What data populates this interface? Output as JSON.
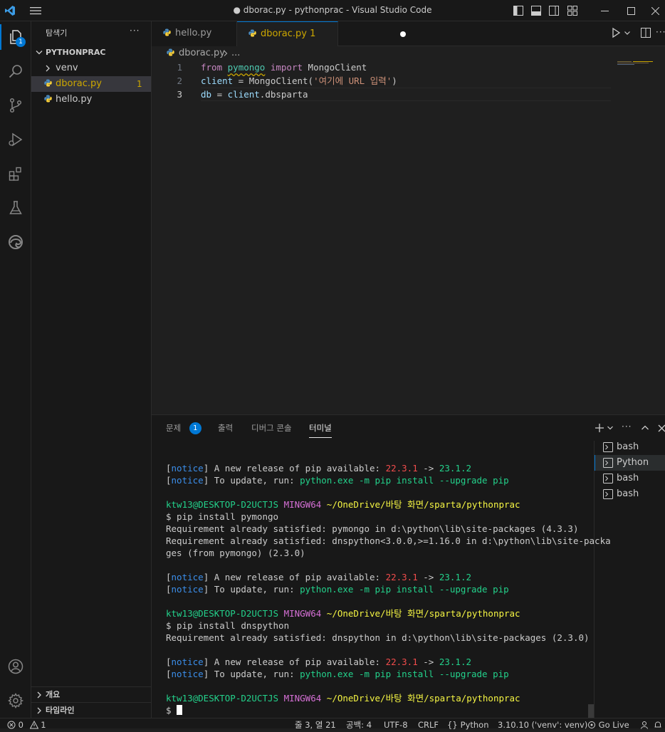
{
  "window": {
    "title": "● dborac.py - pythonprac - Visual Studio Code"
  },
  "activity": {
    "explorer_badge": "1"
  },
  "sidebar": {
    "header": "탐색기",
    "more": "···",
    "project": "PYTHONPRAC",
    "items": [
      {
        "label": "venv"
      },
      {
        "label": "dborac.py",
        "problems": "1"
      },
      {
        "label": "hello.py"
      }
    ],
    "outline": "개요",
    "timeline": "타임라인"
  },
  "tabs": [
    {
      "label": "hello.py"
    },
    {
      "label": "dborac.py 1"
    }
  ],
  "breadcrumb": {
    "file": "dborac.py",
    "rest": "..."
  },
  "editor": {
    "lines": [
      {
        "no": "1",
        "t1": "from",
        "t2": " ",
        "t3": "pymongo",
        "t4": " ",
        "t5": "import",
        "t6": " ",
        "t7": "MongoClient"
      },
      {
        "no": "2",
        "t1": "client",
        "t2": " = ",
        "t3": "MongoClient",
        "t4": "(",
        "t5": "'여기에 URL 입력'",
        "t6": ")"
      },
      {
        "no": "3",
        "t1": "db",
        "t2": " = ",
        "t3": "client",
        "t4": ".dbsparta"
      }
    ]
  },
  "panel": {
    "tabs": [
      {
        "label": "문제",
        "badge": "1"
      },
      {
        "label": "출력"
      },
      {
        "label": "디버그 콘솔"
      },
      {
        "label": "터미널"
      }
    ],
    "terminals": [
      {
        "label": "bash"
      },
      {
        "label": "Python"
      },
      {
        "label": "bash"
      },
      {
        "label": "bash"
      }
    ]
  },
  "terminal": {
    "notice1a": "notice",
    "notice1b": " A new release of pip available: ",
    "ver_old": "22.3.1",
    "arrow": " -> ",
    "ver_new": "23.1.2",
    "notice2b": " To update, run: ",
    "cmd_upgrade": "python.exe -m pip install --upgrade pip",
    "user": "ktw13@DESKTOP-D2UCTJS",
    "env": "MINGW64",
    "path": "~/OneDrive/바탕 화면/sparta/pythonprac",
    "cmd1": "$ pip install pymongo",
    "req1": "Requirement already satisfied: pymongo in d:\\python\\lib\\site-packages (4.3.3)",
    "req2a": "Requirement already satisfied: dnspython<3.0.0,>=1.16.0 in d:\\python\\lib\\site-packa",
    "req2b": "ges (from pymongo) (2.3.0)",
    "cmd2": "$ pip install dnspython",
    "req3": "Requirement already satisfied: dnspython in d:\\python\\lib\\site-packages (2.3.0)",
    "prompt": "$ "
  },
  "status": {
    "errors": "0",
    "warnings": "1",
    "position": "줄 3, 열 21",
    "spaces": "공백: 4",
    "encoding": "UTF-8",
    "eol": "CRLF",
    "language": "Python",
    "interpreter": "3.10.10 ('venv': venv)",
    "golive": "Go Live"
  }
}
